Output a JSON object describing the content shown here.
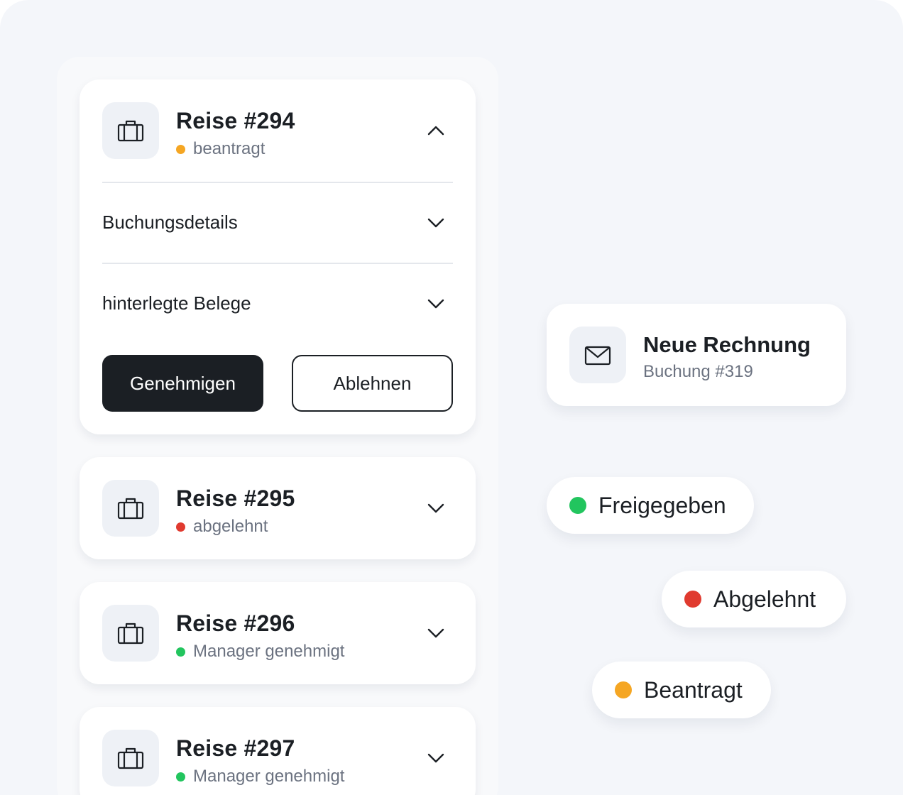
{
  "colors": {
    "orange": "#f5a623",
    "red": "#e03a2f",
    "green": "#22c55e",
    "dark": "#1b1f24",
    "muted": "#6b7280"
  },
  "trips": [
    {
      "title": "Reise #294",
      "status": "beantragt",
      "status_color": "orange",
      "expanded": true
    },
    {
      "title": "Reise #295",
      "status": "abgelehnt",
      "status_color": "red",
      "expanded": false
    },
    {
      "title": "Reise #296",
      "status": "Manager genehmigt",
      "status_color": "green",
      "expanded": false
    },
    {
      "title": "Reise #297",
      "status": "Manager genehmigt",
      "status_color": "green",
      "expanded": false
    }
  ],
  "expanded_sections": [
    "Buchungsdetails",
    "hinterlegte Belege"
  ],
  "actions": {
    "approve_label": "Genehmigen",
    "reject_label": "Ablehnen"
  },
  "notification": {
    "icon": "envelope-icon",
    "title": "Neue Rechnung",
    "subtitle": "Buchung #319"
  },
  "status_pills": [
    {
      "label": "Freigegeben",
      "color": "green"
    },
    {
      "label": "Abgelehnt",
      "color": "red"
    },
    {
      "label": "Beantragt",
      "color": "orange"
    }
  ]
}
